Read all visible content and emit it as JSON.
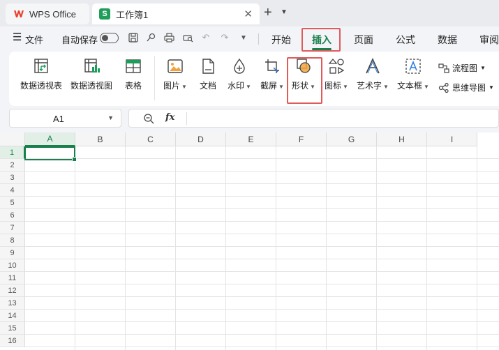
{
  "tabs": {
    "home_label": "WPS Office",
    "doc_label": "工作簿1",
    "doc_icon_letter": "S",
    "close_glyph": "✕",
    "new_tab_glyph": "+",
    "more_glyph": "⌄"
  },
  "menu": {
    "file_label": "文件",
    "autosave_label": "自动保存",
    "ribbon_tabs": [
      "开始",
      "插入",
      "页面",
      "公式",
      "数据",
      "审阅"
    ],
    "active_tab": "插入"
  },
  "ribbon": {
    "pivot_table": "数据透视表",
    "pivot_chart": "数据透视图",
    "table": "表格",
    "picture": "图片",
    "document": "文档",
    "watermark": "水印",
    "screenshot": "截屏",
    "shape": "形状",
    "icon": "图标",
    "wordart": "艺术字",
    "textbox": "文本框",
    "flowchart": "流程图",
    "mindmap": "思维导图",
    "caret": "⌄"
  },
  "formula_bar": {
    "cell_ref": "A1",
    "fx": "fx",
    "value": ""
  },
  "sheet": {
    "columns": [
      "A",
      "B",
      "C",
      "D",
      "E",
      "F",
      "G",
      "H",
      "I"
    ],
    "rows": [
      "1",
      "2",
      "3",
      "4",
      "5",
      "6",
      "7",
      "8",
      "9",
      "10",
      "11",
      "12",
      "13",
      "14",
      "15",
      "16"
    ],
    "active_cell": "A1"
  },
  "colors": {
    "accent_green": "#1a7f4b",
    "highlight_red": "#e05a5a",
    "wps_red": "#e8412c"
  }
}
